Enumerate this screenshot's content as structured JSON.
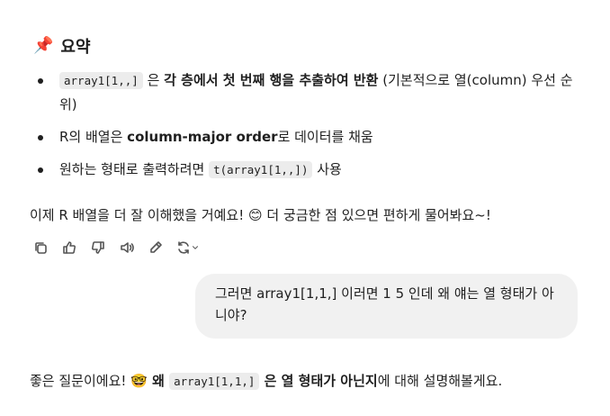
{
  "summary": {
    "pin_icon": "📌",
    "title": "요약",
    "items": [
      {
        "code": "array1[1,,]",
        "after_code": " 은 ",
        "bold": "각 층에서 첫 번째 행을 추출하여 반환",
        "tail": " (기본적으로 열(column) 우선 순위)"
      },
      {
        "pre": "R의 배열은 ",
        "bold": "column-major order",
        "tail": "로 데이터를 채움"
      },
      {
        "pre": "원하는 형태로 출력하려면 ",
        "code": "t(array1[1,,])",
        "tail": " 사용"
      }
    ]
  },
  "closing": {
    "text": "이제 R 배열을 더 잘 이해했을 거예요! ",
    "emoji": "😊",
    "text2": " 더 궁금한 점 있으면 편하게 물어봐요~!"
  },
  "actions": [
    "copy-icon",
    "thumbs-up-icon",
    "thumbs-down-icon",
    "speaker-icon",
    "edit-icon",
    "regenerate-icon",
    "chevron-down-icon"
  ],
  "user_message": {
    "text": "그러면  array1[1,1,] 이러면 1 5 인데 왜 얘는 열 형태가 아니야?"
  },
  "answer": {
    "pre": "좋은 질문이에요! ",
    "emoji": "🤓",
    "bold1": " 왜 ",
    "code": "array1[1,1,]",
    "bold2": " 은 열 형태가 아닌지",
    "tail": "에 대해 설명해볼게요."
  }
}
